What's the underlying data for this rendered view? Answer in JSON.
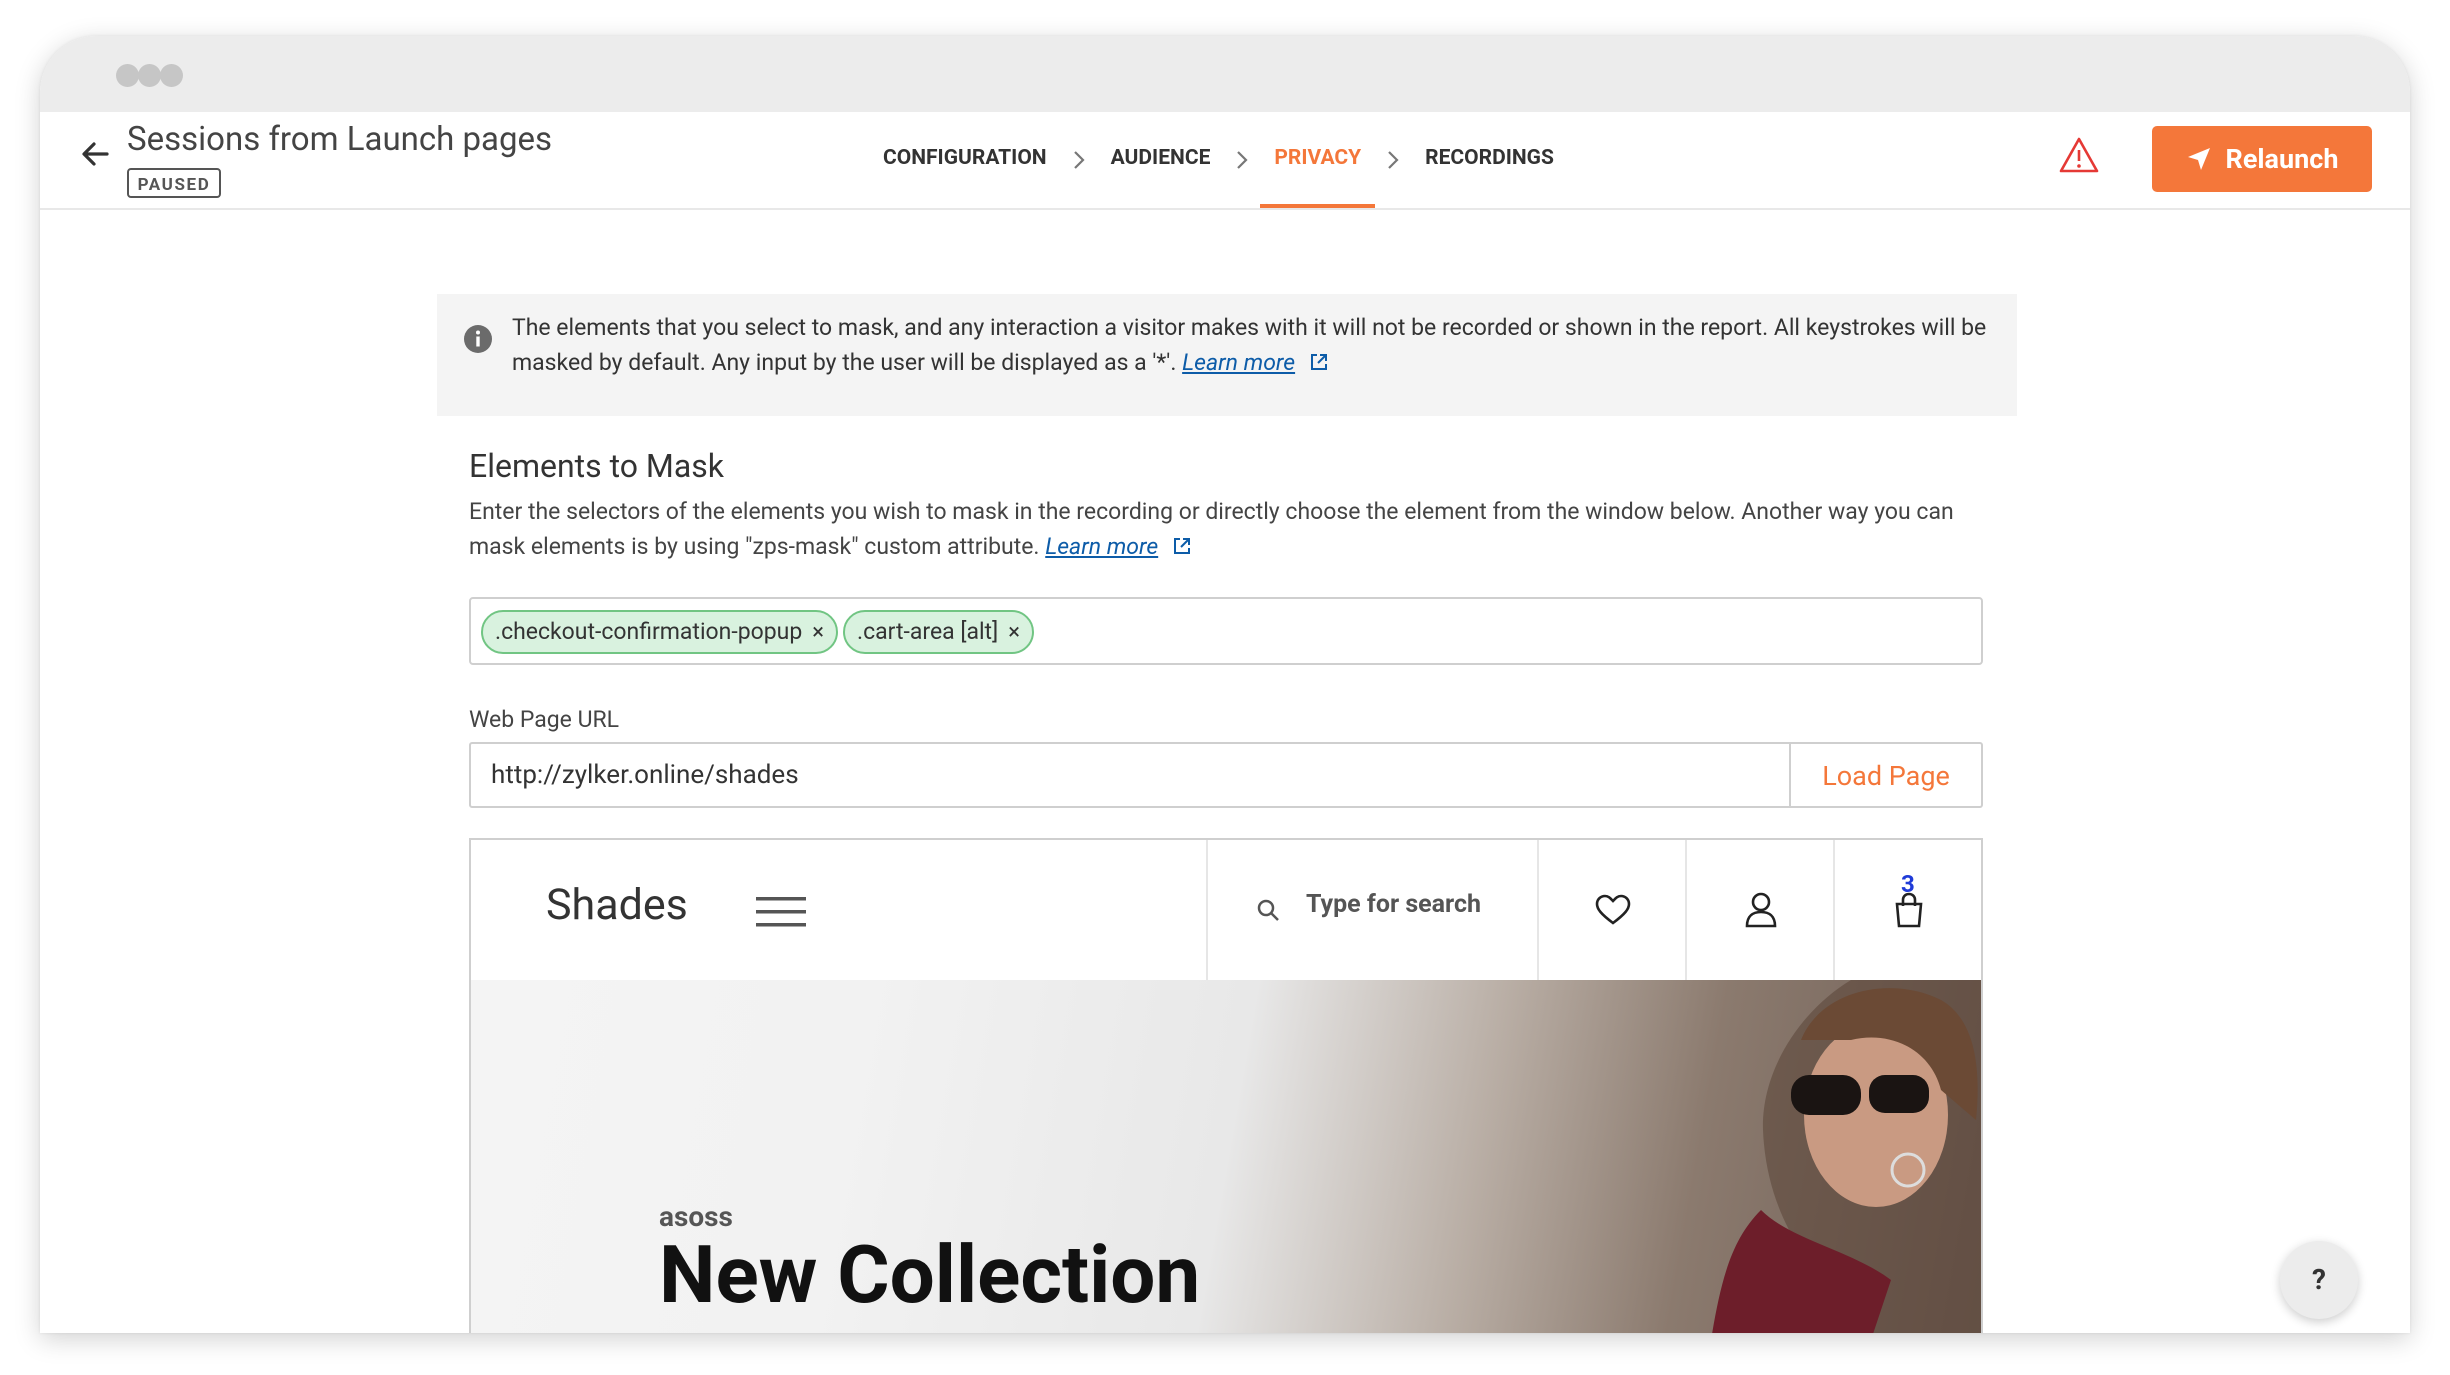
{
  "header": {
    "title": "Sessions from Launch pages",
    "status_badge": "PAUSED",
    "steps": [
      {
        "label": "CONFIGURATION"
      },
      {
        "label": "AUDIENCE"
      },
      {
        "label": "PRIVACY"
      },
      {
        "label": "RECORDINGS"
      }
    ],
    "active_step": "PRIVACY",
    "relaunch_label": "Relaunch"
  },
  "info": {
    "text": "The elements that you select to mask, and any interaction a visitor makes with it will not be recorded or shown in the report. All keystrokes will be masked by default. Any input by the user will be displayed as a '*'.",
    "link": "Learn more"
  },
  "mask_section": {
    "title": "Elements to Mask",
    "description": "Enter the selectors of the elements you wish to mask in the recording or directly choose the element from the window below. Another way you can mask elements is by using \"zps-mask\" custom attribute.",
    "link": "Learn more",
    "tags": [
      ".checkout-confirmation-popup",
      ".cart-area [alt]"
    ],
    "tag_remove": "×"
  },
  "url_section": {
    "label": "Web Page URL",
    "value": "http://zylker.online/shades",
    "load_button": "Load Page"
  },
  "preview": {
    "brand": "Shades",
    "search_placeholder": "Type for search",
    "cart_count": "3",
    "hero_brand": "asoss",
    "hero_title": "New Collection"
  },
  "help_label": "?",
  "colors": {
    "accent": "#f4773a",
    "tag_bg": "#d9f2df",
    "tag_border": "#71c583",
    "link": "#0d5ca8",
    "warning": "#e53935"
  },
  "icons": [
    "back-arrow-icon",
    "chevron-right-icon",
    "warning-icon",
    "send-icon",
    "info-icon",
    "external-link-icon",
    "hamburger-icon",
    "search-icon",
    "heart-icon",
    "user-icon",
    "shopping-bag-icon"
  ]
}
